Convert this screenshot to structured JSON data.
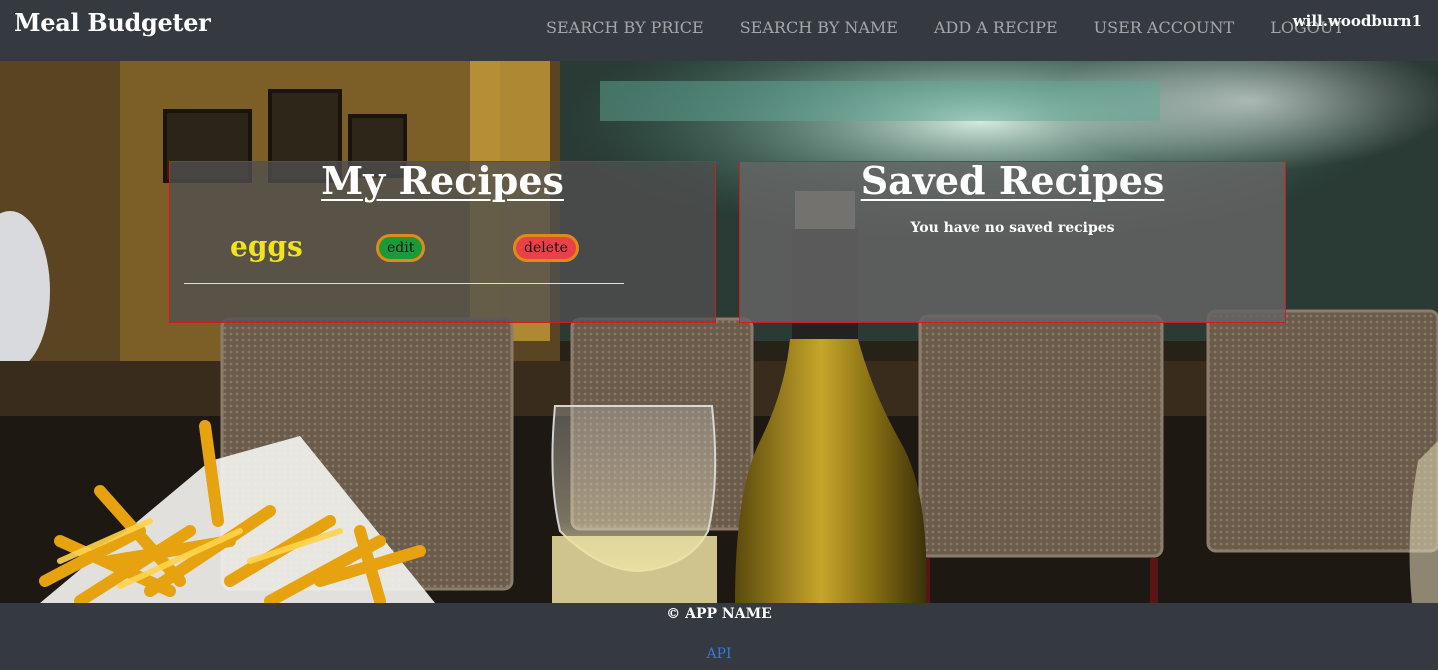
{
  "navbar": {
    "brand": "Meal Budgeter",
    "links": [
      {
        "label": "SEARCH BY PRICE"
      },
      {
        "label": "SEARCH BY NAME"
      },
      {
        "label": "ADD A RECIPE"
      },
      {
        "label": "USER ACCOUNT"
      },
      {
        "label": "LOGOUT"
      }
    ],
    "username": "will.woodburn1"
  },
  "my_recipes": {
    "title": "My Recipes",
    "items": [
      {
        "name": "eggs",
        "edit_label": "edit",
        "delete_label": "delete"
      }
    ]
  },
  "saved_recipes": {
    "title": "Saved Recipes",
    "empty_message": "You have no saved recipes"
  },
  "footer": {
    "copyright": "© APP NAME",
    "api_link": "API"
  },
  "colors": {
    "navbar_bg": "#343a40",
    "panel_border": "#d21b1b",
    "recipe_name": "#f2e31c",
    "edit_button": "#1a9a38",
    "delete_button": "#e84148",
    "button_border": "#e08a17",
    "api_link": "#2f7ae5"
  }
}
